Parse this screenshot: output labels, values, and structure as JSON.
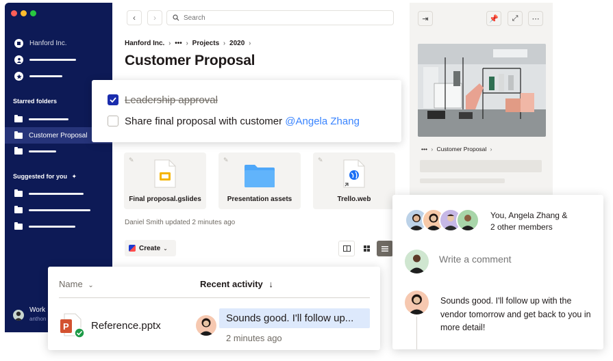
{
  "sidebar": {
    "org_name": "Hanford Inc.",
    "starred_heading": "Starred folders",
    "starred_selected": "Customer Proposal",
    "suggested_heading": "Suggested for you",
    "workspace_name": "Work",
    "workspace_user": "anthon"
  },
  "search": {
    "placeholder": "Search"
  },
  "breadcrumb": {
    "org": "Hanford Inc.",
    "more": "•••",
    "projects": "Projects",
    "year": "2020"
  },
  "page_title": "Customer Proposal",
  "checklist": {
    "item1": "Leadership approval",
    "item2_text": "Share final proposal with customer",
    "item2_mention": "@Angela Zhang"
  },
  "files": [
    {
      "name": "Final proposal.gslides",
      "icon": "slides-file-icon"
    },
    {
      "name": "Presentation assets",
      "icon": "folder-icon"
    },
    {
      "name": "Trello.web",
      "icon": "web-link-icon"
    }
  ],
  "updated_text": "Daniel Smith updated 2 minutes ago",
  "create_label": "Create",
  "preview": {
    "breadcrumb_more": "•••",
    "breadcrumb_current": "Customer Proposal"
  },
  "comments": {
    "members_line1": "You, Angela Zhang &",
    "members_line2": "2 other members",
    "placeholder": "Write a comment",
    "comment_text": "Sounds good. I'll follow up with the vendor tomorrow and get back to you in more detail!"
  },
  "activity": {
    "col_name": "Name",
    "col_recent": "Recent activity",
    "file_name": "Reference.pptx",
    "message": "Sounds good. I'll follow up...",
    "time": "2 minutes ago"
  },
  "colors": {
    "sidebar_bg": "#0d1a56",
    "accent_blue": "#0061fe",
    "mention": "#3984ff",
    "check_bg": "#1a2cad",
    "folder_blue": "#4ea7f9",
    "pptx_orange": "#d35230",
    "success_green": "#1d9b47"
  }
}
